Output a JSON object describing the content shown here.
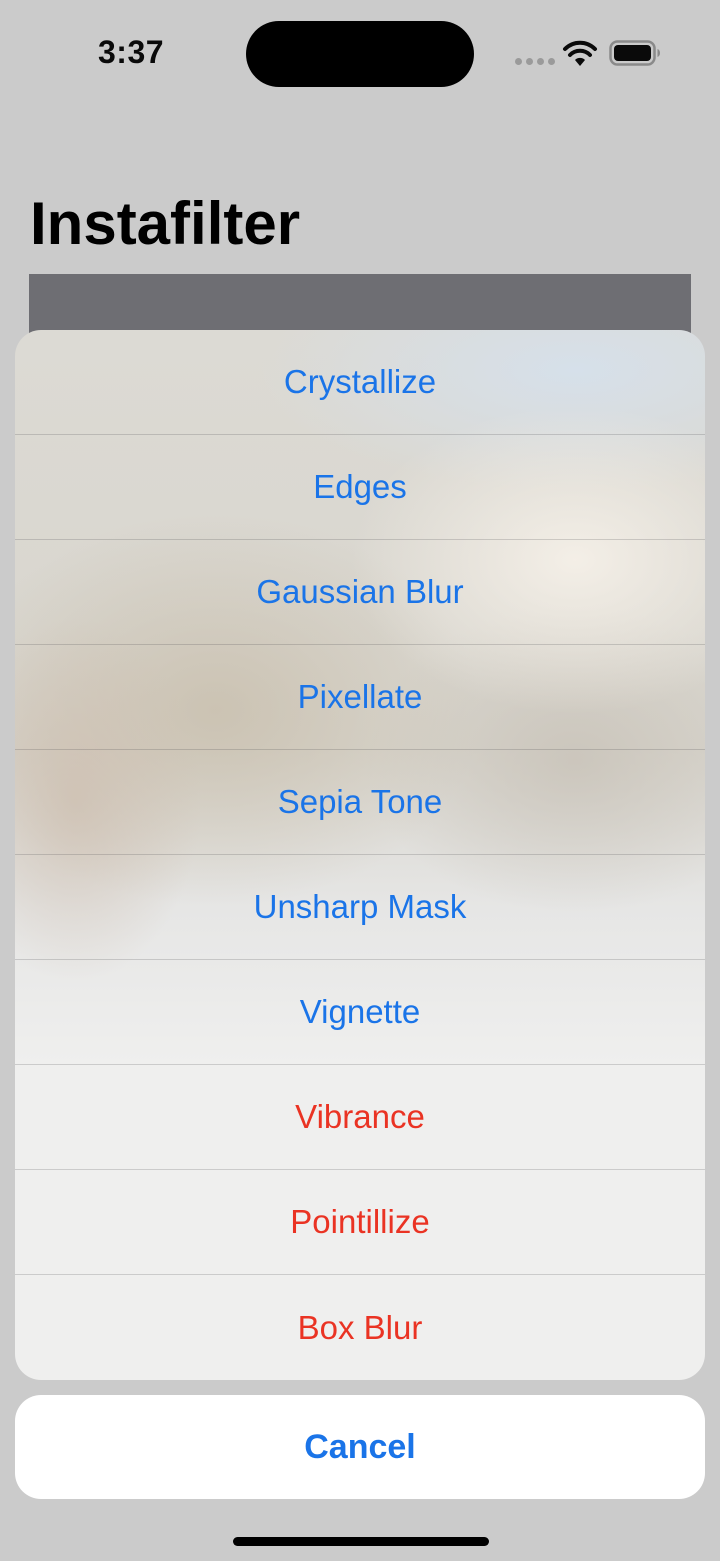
{
  "status_bar": {
    "time": "3:37"
  },
  "header": {
    "title": "Instafilter"
  },
  "action_sheet": {
    "items": [
      {
        "label": "Crystallize",
        "style": "default"
      },
      {
        "label": "Edges",
        "style": "default"
      },
      {
        "label": "Gaussian Blur",
        "style": "default"
      },
      {
        "label": "Pixellate",
        "style": "default"
      },
      {
        "label": "Sepia Tone",
        "style": "default"
      },
      {
        "label": "Unsharp Mask",
        "style": "default"
      },
      {
        "label": "Vignette",
        "style": "default"
      },
      {
        "label": "Vibrance",
        "style": "destructive"
      },
      {
        "label": "Pointillize",
        "style": "destructive"
      },
      {
        "label": "Box Blur",
        "style": "destructive"
      }
    ],
    "cancel_label": "Cancel"
  },
  "colors": {
    "accent": "#1a74e8",
    "destructive": "#ea3323",
    "background": "#cbcbcb"
  },
  "icons": [
    "wifi-icon",
    "battery-icon",
    "cellular-signal-icon"
  ]
}
